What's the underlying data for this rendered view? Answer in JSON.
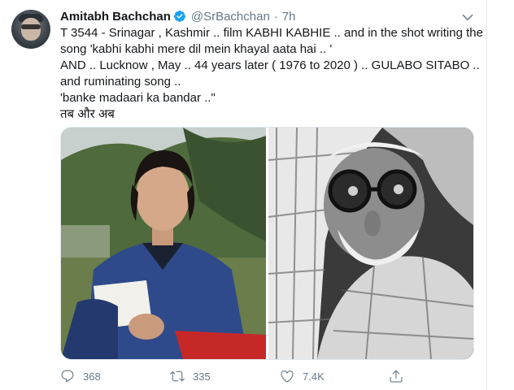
{
  "tweet": {
    "author": {
      "name": "Amitabh Bachchan",
      "handle": "@SrBachchan",
      "verified": true,
      "time": "7h",
      "separator": "·",
      "avatar_icon": "avatar-image"
    },
    "text_lines": [
      "T 3544 - Srinagar , Kashmir .. film KABHI KABHIE .. and in the shot writing the",
      "song 'kabhi kabhi mere dil mein khayal aata hai .. '",
      "AND .. Lucknow , May .. 44 years later ( 1976 to 2020 ) .. GULABO SITABO ..",
      "and ruminating song ..",
      "'banke madaari ka bandar ..\"",
      "तब और अब"
    ],
    "media": [
      {
        "kind": "photo",
        "description_icon": "photo-young-man"
      },
      {
        "kind": "photo",
        "description_icon": "photo-old-man"
      }
    ],
    "actions": {
      "reply_count": "368",
      "retweet_count": "335",
      "like_count": "7.4K",
      "reply_icon": "reply-icon",
      "retweet_icon": "retweet-icon",
      "like_icon": "like-icon",
      "share_icon": "share-icon"
    }
  },
  "colors": {
    "text": "#14171a",
    "muted": "#657786",
    "verified": "#1da1f2",
    "border": "#e6ecf0"
  }
}
